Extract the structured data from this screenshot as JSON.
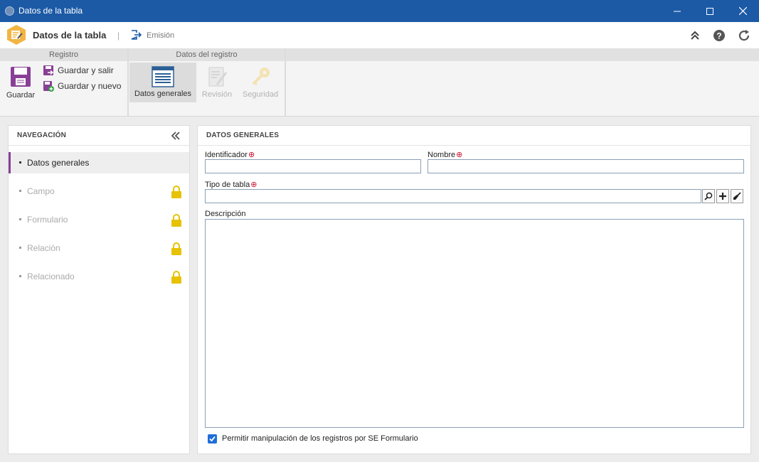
{
  "window": {
    "title": "Datos de la tabla"
  },
  "header": {
    "title": "Datos de la tabla",
    "emision_label": "Emisión"
  },
  "ribbon": {
    "group_registro": "Registro",
    "group_datos_registro": "Datos del registro",
    "guardar": "Guardar",
    "guardar_salir": "Guardar y salir",
    "guardar_nuevo": "Guardar y nuevo",
    "datos_generales": "Datos generales",
    "revision": "Revisión",
    "seguridad": "Seguridad"
  },
  "navigation": {
    "title": "NAVEGACIÓN",
    "items": [
      {
        "label": "Datos generales",
        "locked": false,
        "active": true
      },
      {
        "label": "Campo",
        "locked": true
      },
      {
        "label": "Formulario",
        "locked": true
      },
      {
        "label": "Relación",
        "locked": true
      },
      {
        "label": "Relacionado",
        "locked": true
      }
    ]
  },
  "form": {
    "title": "DATOS GENERALES",
    "identificador_label": "Identificador",
    "identificador_value": "",
    "nombre_label": "Nombre",
    "nombre_value": "",
    "tipo_tabla_label": "Tipo de tabla",
    "tipo_tabla_value": "",
    "descripcion_label": "Descripción",
    "descripcion_value": "",
    "required_mark": "⊕",
    "checkbox_label": "Permitir manipulación de los registros por SE Formulario",
    "checkbox_checked": true
  },
  "colors": {
    "titlebar": "#1c5aa6",
    "accent": "#8a3f96",
    "lock": "#e6c200",
    "logo": "#f2b544"
  }
}
